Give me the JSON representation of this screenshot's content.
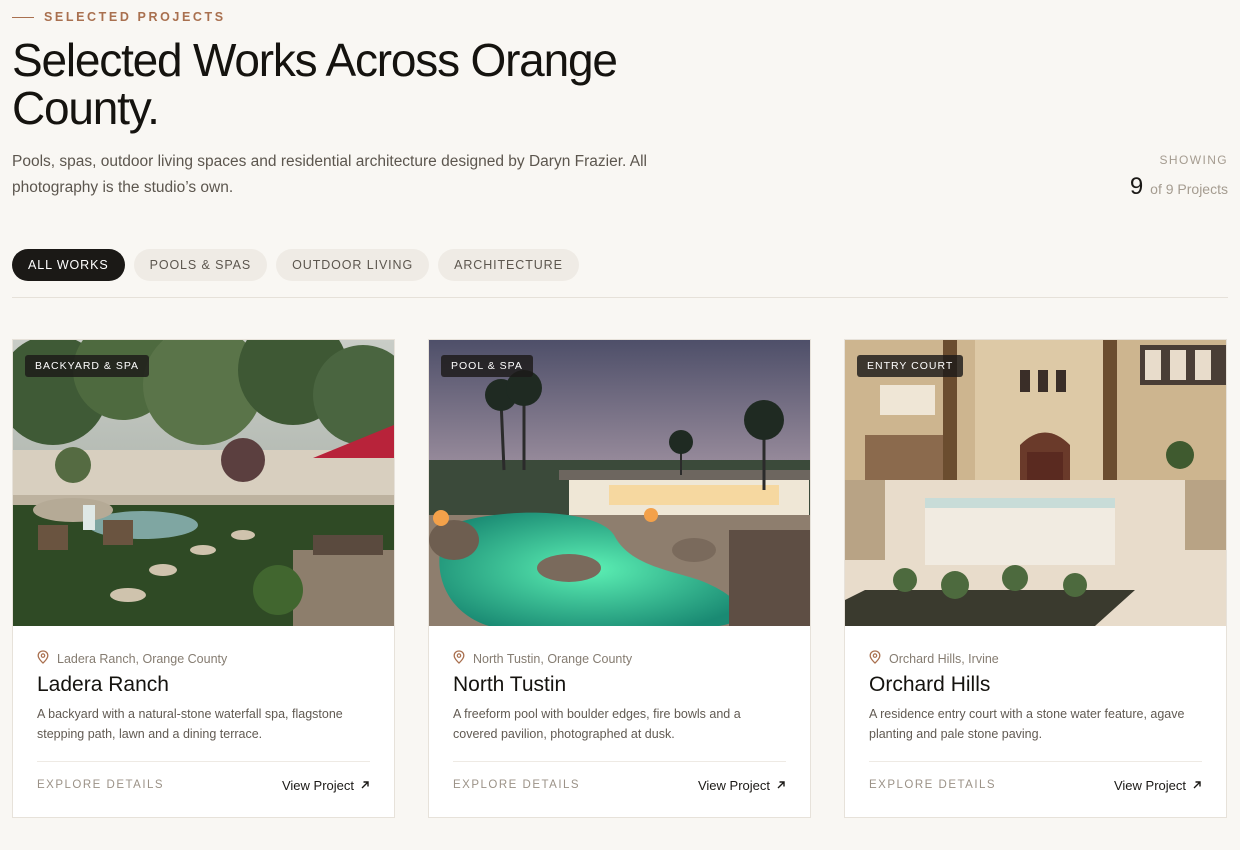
{
  "section": {
    "eyebrow": "SELECTED PROJECTS",
    "title": "Selected Works Across Orange County.",
    "description": "Pools, spas, outdoor living spaces and residential architecture designed by Daryn Frazier. All photography is the studio’s own."
  },
  "showing": {
    "label": "SHOWING",
    "count": "9",
    "of_text": "of 9 Projects"
  },
  "filters": [
    {
      "label": "ALL WORKS",
      "active": true
    },
    {
      "label": "POOLS & SPAS",
      "active": false
    },
    {
      "label": "OUTDOOR LIVING",
      "active": false
    },
    {
      "label": "ARCHITECTURE",
      "active": false
    }
  ],
  "projects": [
    {
      "tag": "BACKYARD & SPA",
      "location": "Ladera Ranch, Orange County",
      "title": "Ladera Ranch",
      "description": "A backyard with a natural-stone waterfall spa, flagstone stepping path, lawn and a dining terrace.",
      "explore": "EXPLORE DETAILS",
      "link": "View Project"
    },
    {
      "tag": "POOL & SPA",
      "location": "North Tustin, Orange County",
      "title": "North Tustin",
      "description": "A freeform pool with boulder edges, fire bowls and a covered pavilion, photographed at dusk.",
      "explore": "EXPLORE DETAILS",
      "link": "View Project"
    },
    {
      "tag": "ENTRY COURT",
      "location": "Orchard Hills, Irvine",
      "title": "Orchard Hills",
      "description": "A residence entry court with a stone water feature, agave planting and pale stone paving.",
      "explore": "EXPLORE DETAILS",
      "link": "View Project"
    }
  ],
  "colors": {
    "accent": "#a9704f",
    "background": "#f9f7f3",
    "active_chip": "#1b1916",
    "chip": "#efebe5"
  },
  "icons": {
    "location": "map-pin-icon",
    "link": "arrow-up-right-icon"
  }
}
